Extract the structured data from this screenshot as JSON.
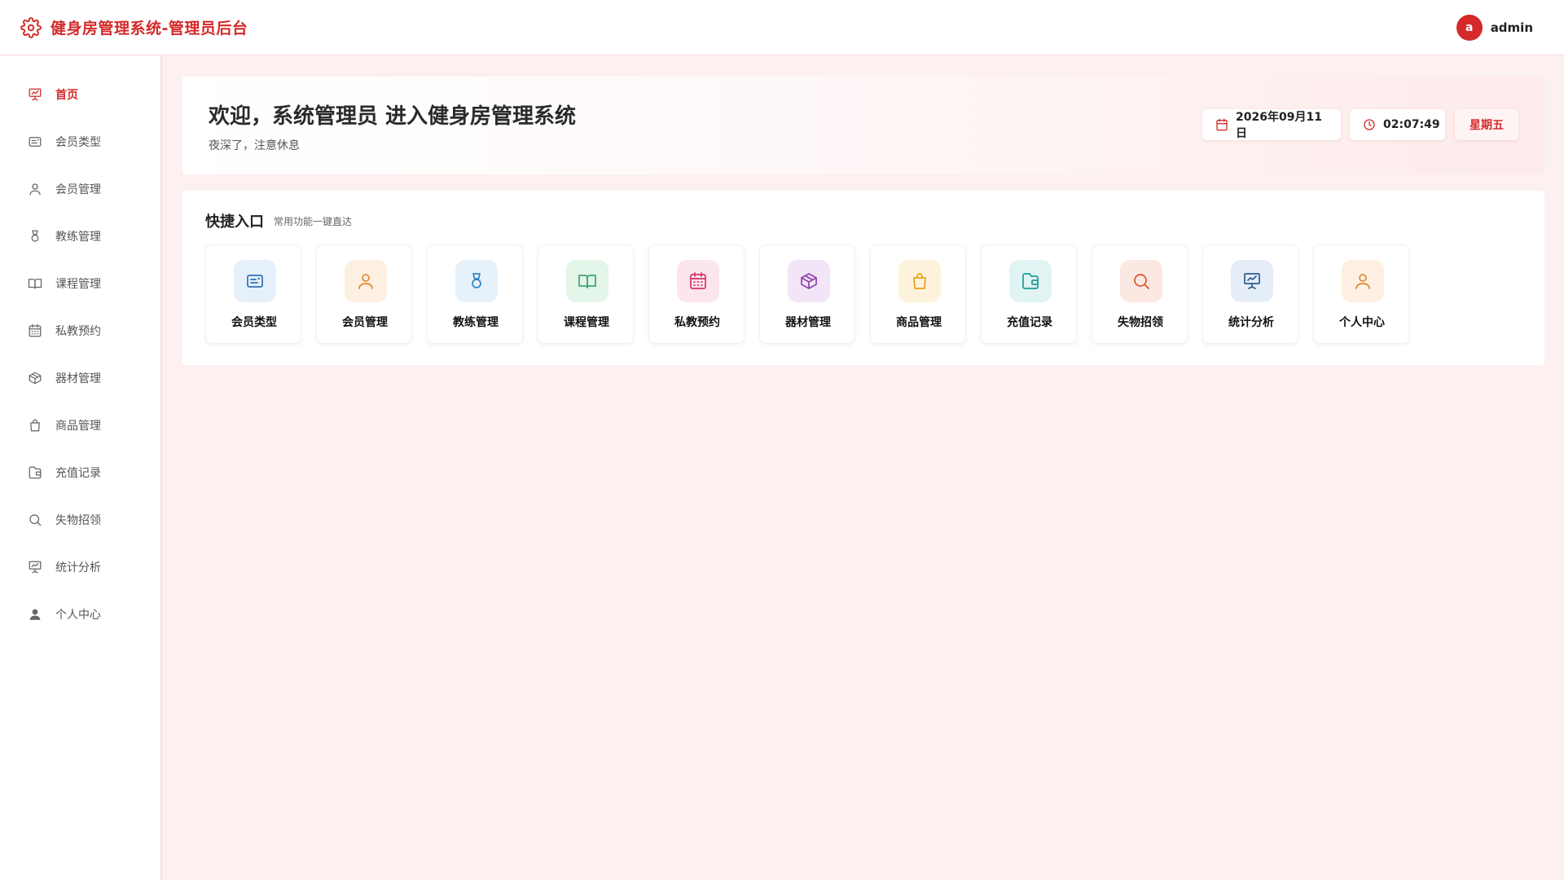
{
  "app": {
    "title": "健身房管理系统-管理员后台"
  },
  "user": {
    "avatar_letter": "a",
    "name": "admin"
  },
  "sidebar": {
    "items": [
      {
        "label": "首页",
        "icon": "presentation-chart-icon",
        "active": true
      },
      {
        "label": "会员类型",
        "icon": "id-card-icon"
      },
      {
        "label": "会员管理",
        "icon": "user-icon"
      },
      {
        "label": "教练管理",
        "icon": "medal-icon"
      },
      {
        "label": "课程管理",
        "icon": "book-open-icon"
      },
      {
        "label": "私教预约",
        "icon": "calendar-icon"
      },
      {
        "label": "器材管理",
        "icon": "package-icon"
      },
      {
        "label": "商品管理",
        "icon": "shopping-bag-icon"
      },
      {
        "label": "充值记录",
        "icon": "wallet-icon"
      },
      {
        "label": "失物招领",
        "icon": "search-icon"
      },
      {
        "label": "统计分析",
        "icon": "presentation-chart-icon"
      },
      {
        "label": "个人中心",
        "icon": "user-filled-icon"
      }
    ]
  },
  "welcome": {
    "title": "欢迎，系统管理员 进入健身房管理系统",
    "subtitle": "夜深了，注意休息",
    "date": "2026年09月11日",
    "time": "02:07:49",
    "weekday": "星期五"
  },
  "quick": {
    "title": "快捷入口",
    "subtitle": "常用功能一键直达",
    "items": [
      {
        "label": "会员类型",
        "icon": "id-card-icon",
        "color": "#2f6fb5",
        "bg": "#e6f0fb"
      },
      {
        "label": "会员管理",
        "icon": "user-icon",
        "color": "#e08a2e",
        "bg": "#fdf0e2"
      },
      {
        "label": "教练管理",
        "icon": "medal-icon",
        "color": "#2f86c4",
        "bg": "#e6f2fb"
      },
      {
        "label": "课程管理",
        "icon": "book-open-icon",
        "color": "#3aa66a",
        "bg": "#e4f5ea"
      },
      {
        "label": "私教预约",
        "icon": "calendar-icon",
        "color": "#d6336c",
        "bg": "#fbe5ee"
      },
      {
        "label": "器材管理",
        "icon": "package-icon",
        "color": "#8e44ad",
        "bg": "#f1e5f7"
      },
      {
        "label": "商品管理",
        "icon": "shopping-bag-icon",
        "color": "#e6a117",
        "bg": "#fdf3dc"
      },
      {
        "label": "充值记录",
        "icon": "wallet-icon",
        "color": "#1e9a9a",
        "bg": "#e0f4f4"
      },
      {
        "label": "失物招领",
        "icon": "search-icon",
        "color": "#d9552b",
        "bg": "#fbe8e2"
      },
      {
        "label": "统计分析",
        "icon": "presentation-chart-icon",
        "color": "#2c5d8f",
        "bg": "#e5eef8"
      },
      {
        "label": "个人中心",
        "icon": "user-icon",
        "color": "#e08a2e",
        "bg": "#fdf0e2"
      }
    ]
  },
  "colors": {
    "accent": "#d42a2a",
    "sidebar_icon": "#666666"
  }
}
